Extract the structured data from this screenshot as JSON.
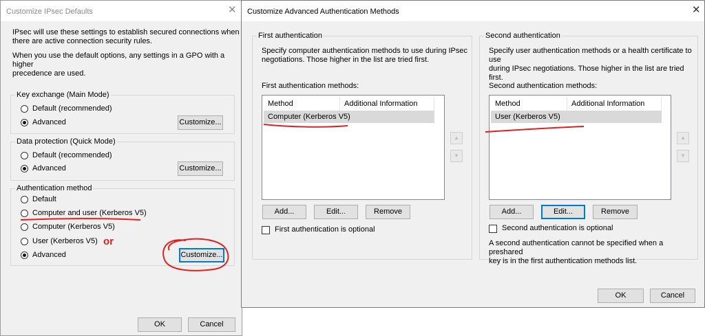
{
  "ipsec_dialog": {
    "title": "Customize IPsec Defaults",
    "intro_line1": "IPsec will use these settings to establish secured connections when",
    "intro_line2": "there are active connection security rules.",
    "gpo_line1": "When you use the default options, any settings in a GPO with a higher",
    "gpo_line2": "precedence are used.",
    "key_exchange": {
      "legend": "Key exchange (Main Mode)",
      "options": [
        "Default (recommended)",
        "Advanced"
      ],
      "selected": "Advanced",
      "customize_label": "Customize..."
    },
    "data_protection": {
      "legend": "Data protection (Quick Mode)",
      "options": [
        "Default (recommended)",
        "Advanced"
      ],
      "selected": "Advanced",
      "customize_label": "Customize..."
    },
    "auth_method": {
      "legend": "Authentication method",
      "options": [
        "Default",
        "Computer and user (Kerberos V5)",
        "Computer (Kerberos V5)",
        "User (Kerberos V5)",
        "Advanced"
      ],
      "selected": "Advanced",
      "customize_label": "Customize..."
    },
    "ok_label": "OK",
    "cancel_label": "Cancel"
  },
  "annotation": {
    "or_text": "or",
    "color": "#e02020"
  },
  "advanced_dialog": {
    "title": "Customize Advanced Authentication Methods",
    "first": {
      "legend": "First authentication",
      "desc_line1": "Specify computer authentication methods to use during IPsec",
      "desc_line2": "negotiations.  Those higher in the list are tried first.",
      "list_label": "First authentication methods:",
      "columns": [
        "Method",
        "Additional Information"
      ],
      "rows": [
        {
          "method": "Computer (Kerberos V5)",
          "info": ""
        }
      ],
      "add_label": "Add...",
      "edit_label": "Edit...",
      "remove_label": "Remove",
      "optional_label": "First authentication is optional",
      "optional_checked": false
    },
    "second": {
      "legend": "Second authentication",
      "desc_line1": "Specify user authentication methods or a health certificate to use",
      "desc_line2": "during IPsec negotiations.  Those higher in the list are tried first.",
      "list_label": "Second authentication methods:",
      "columns": [
        "Method",
        "Additional Information"
      ],
      "rows": [
        {
          "method": "User (Kerberos V5)",
          "info": ""
        }
      ],
      "add_label": "Add...",
      "edit_label": "Edit...",
      "remove_label": "Remove",
      "optional_label": "Second authentication is optional",
      "optional_checked": false,
      "note_line1": "A second authentication cannot be specified when a preshared",
      "note_line2": "key is in the first authentication methods list."
    },
    "ok_label": "OK",
    "cancel_label": "Cancel"
  }
}
